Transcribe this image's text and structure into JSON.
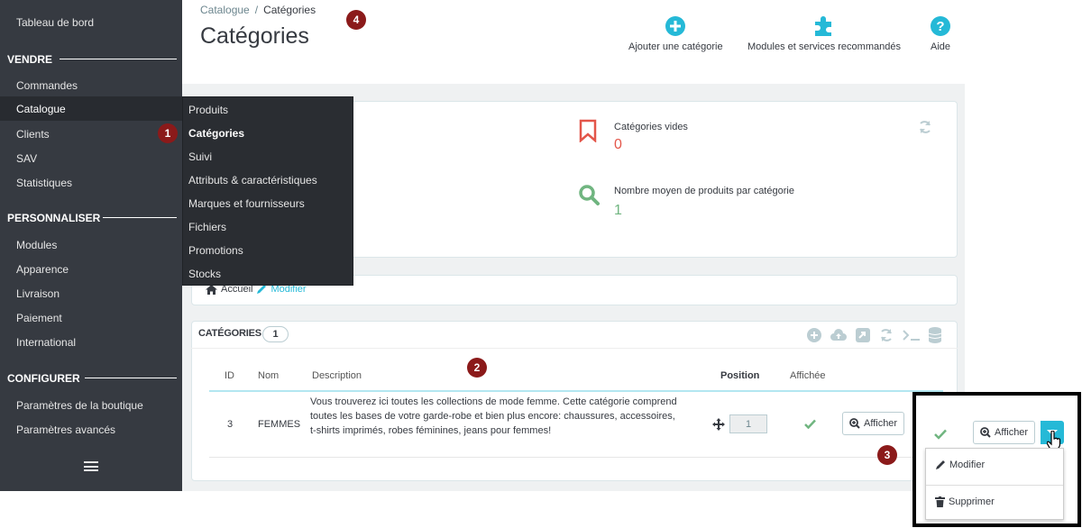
{
  "sidebar": {
    "top_item": "Tableau de bord",
    "sections": [
      {
        "title": "VENDRE",
        "items": [
          "Commandes",
          "Catalogue",
          "Clients",
          "SAV",
          "Statistiques"
        ]
      },
      {
        "title": "PERSONNALISER",
        "items": [
          "Modules",
          "Apparence",
          "Livraison",
          "Paiement",
          "International"
        ]
      },
      {
        "title": "CONFIGURER",
        "items": [
          "Paramètres de la boutique",
          "Paramètres avancés"
        ]
      }
    ],
    "active_item": "Catalogue",
    "flyout": [
      "Produits",
      "Catégories",
      "Suivi",
      "Attributs & caractéristiques",
      "Marques et fournisseurs",
      "Fichiers",
      "Promotions",
      "Stocks"
    ]
  },
  "header": {
    "breadcrumb_parent": "Catalogue",
    "breadcrumb_sep": "/",
    "breadcrumb_current": "Catégories",
    "title": "Catégories",
    "actions": [
      "Ajouter une catégorie",
      "Modules et services recommandés",
      "Aide"
    ]
  },
  "kpis": {
    "empty_label": "Catégories vides",
    "empty_value": "0",
    "avg_label": "Nombre moyen de produits par catégorie",
    "avg_value": "1"
  },
  "category_nav": {
    "home": "Accueil",
    "edit": "Modifier"
  },
  "list": {
    "title": "CATÉGORIES",
    "count": "1",
    "headers": {
      "id": "ID",
      "name": "Nom",
      "description": "Description",
      "position": "Position",
      "displayed": "Affichée"
    },
    "rows": [
      {
        "id": "3",
        "name": "FEMMES",
        "description": "Vous trouverez ici toutes les collections de mode femme. Cette catégorie comprend toutes les bases de votre garde-robe et bien plus encore: chaussures, accessoires, t-shirts imprimés, robes féminines, jeans pour femmes!",
        "position": "1",
        "view_label": "Afficher"
      }
    ]
  },
  "zoom": {
    "view_label": "Afficher",
    "menu": [
      "Modifier",
      "Supprimer"
    ]
  },
  "badges": [
    "1",
    "2",
    "3",
    "4"
  ],
  "colors": {
    "sidebar": "#363a41",
    "accent": "#25b9d7",
    "danger": "#e3564a",
    "success": "#70b580",
    "badge": "#8b1a1a"
  }
}
